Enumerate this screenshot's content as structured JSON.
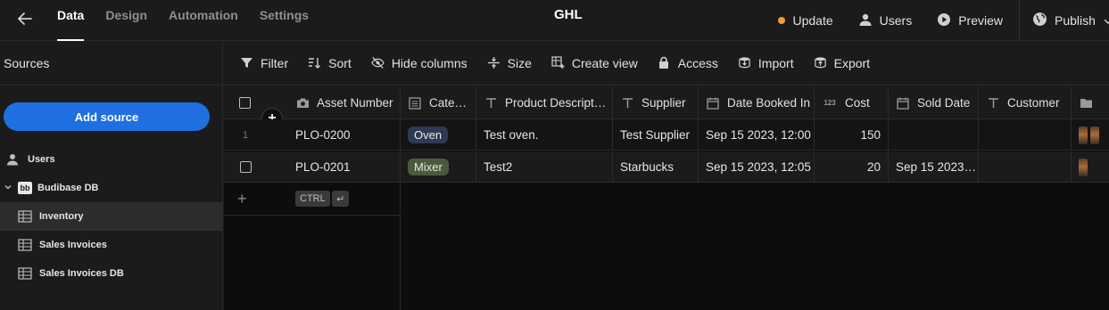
{
  "header": {
    "tabs": [
      {
        "label": "Data"
      },
      {
        "label": "Design"
      },
      {
        "label": "Automation"
      },
      {
        "label": "Settings"
      }
    ],
    "app_name": "GHL",
    "actions": {
      "update": "Update",
      "users": "Users",
      "preview": "Preview",
      "publish": "Publish"
    },
    "update_dot_color": "#f39c34"
  },
  "sidebar": {
    "title": "Sources",
    "add_source": "Add source",
    "items": [
      {
        "label": "Users",
        "icon": "user-icon"
      },
      {
        "label": "Budibase DB",
        "icon": "budibase-logo-icon",
        "logo_text": "bb"
      },
      {
        "label": "Inventory",
        "icon": "table-icon"
      },
      {
        "label": "Sales Invoices",
        "icon": "table-icon"
      },
      {
        "label": "Sales Invoices DB",
        "icon": "table-icon"
      }
    ]
  },
  "toolbar": {
    "filter": "Filter",
    "sort": "Sort",
    "hide_columns": "Hide columns",
    "size": "Size",
    "create_view": "Create view",
    "access": "Access",
    "import": "Import",
    "export": "Export"
  },
  "grid": {
    "columns": [
      {
        "label": "Asset Number",
        "icon": "camera-icon"
      },
      {
        "label": "Cate…",
        "icon": "options-icon"
      },
      {
        "label": "Product Descript…",
        "icon": "text-icon"
      },
      {
        "label": "Supplier",
        "icon": "text-icon"
      },
      {
        "label": "Date Booked In",
        "icon": "calendar-icon"
      },
      {
        "label": "Cost",
        "icon": "number-icon",
        "icon_text": "123"
      },
      {
        "label": "Sold Date",
        "icon": "calendar-icon"
      },
      {
        "label": "Customer",
        "icon": "text-icon"
      },
      {
        "label": "",
        "icon": "folder-icon"
      }
    ],
    "rows": [
      {
        "index": "1",
        "asset_number": "PLO-0200",
        "category": "Oven",
        "category_color": "#2e3a55",
        "product_description": "Test oven.",
        "supplier": "Test Supplier",
        "date_booked_in": "Sep 15 2023, 12:00",
        "cost": "150",
        "sold_date": "",
        "customer": ""
      },
      {
        "index": "",
        "asset_number": "PLO-0201",
        "category": "Mixer",
        "category_color": "#4c5a3c",
        "product_description": "Test2",
        "supplier": "Starbucks",
        "date_booked_in": "Sep 15 2023, 12:05",
        "cost": "20",
        "sold_date": "Sep 15 2023…",
        "customer": ""
      }
    ],
    "shortcut_keys": [
      "CTRL",
      "↵"
    ]
  }
}
